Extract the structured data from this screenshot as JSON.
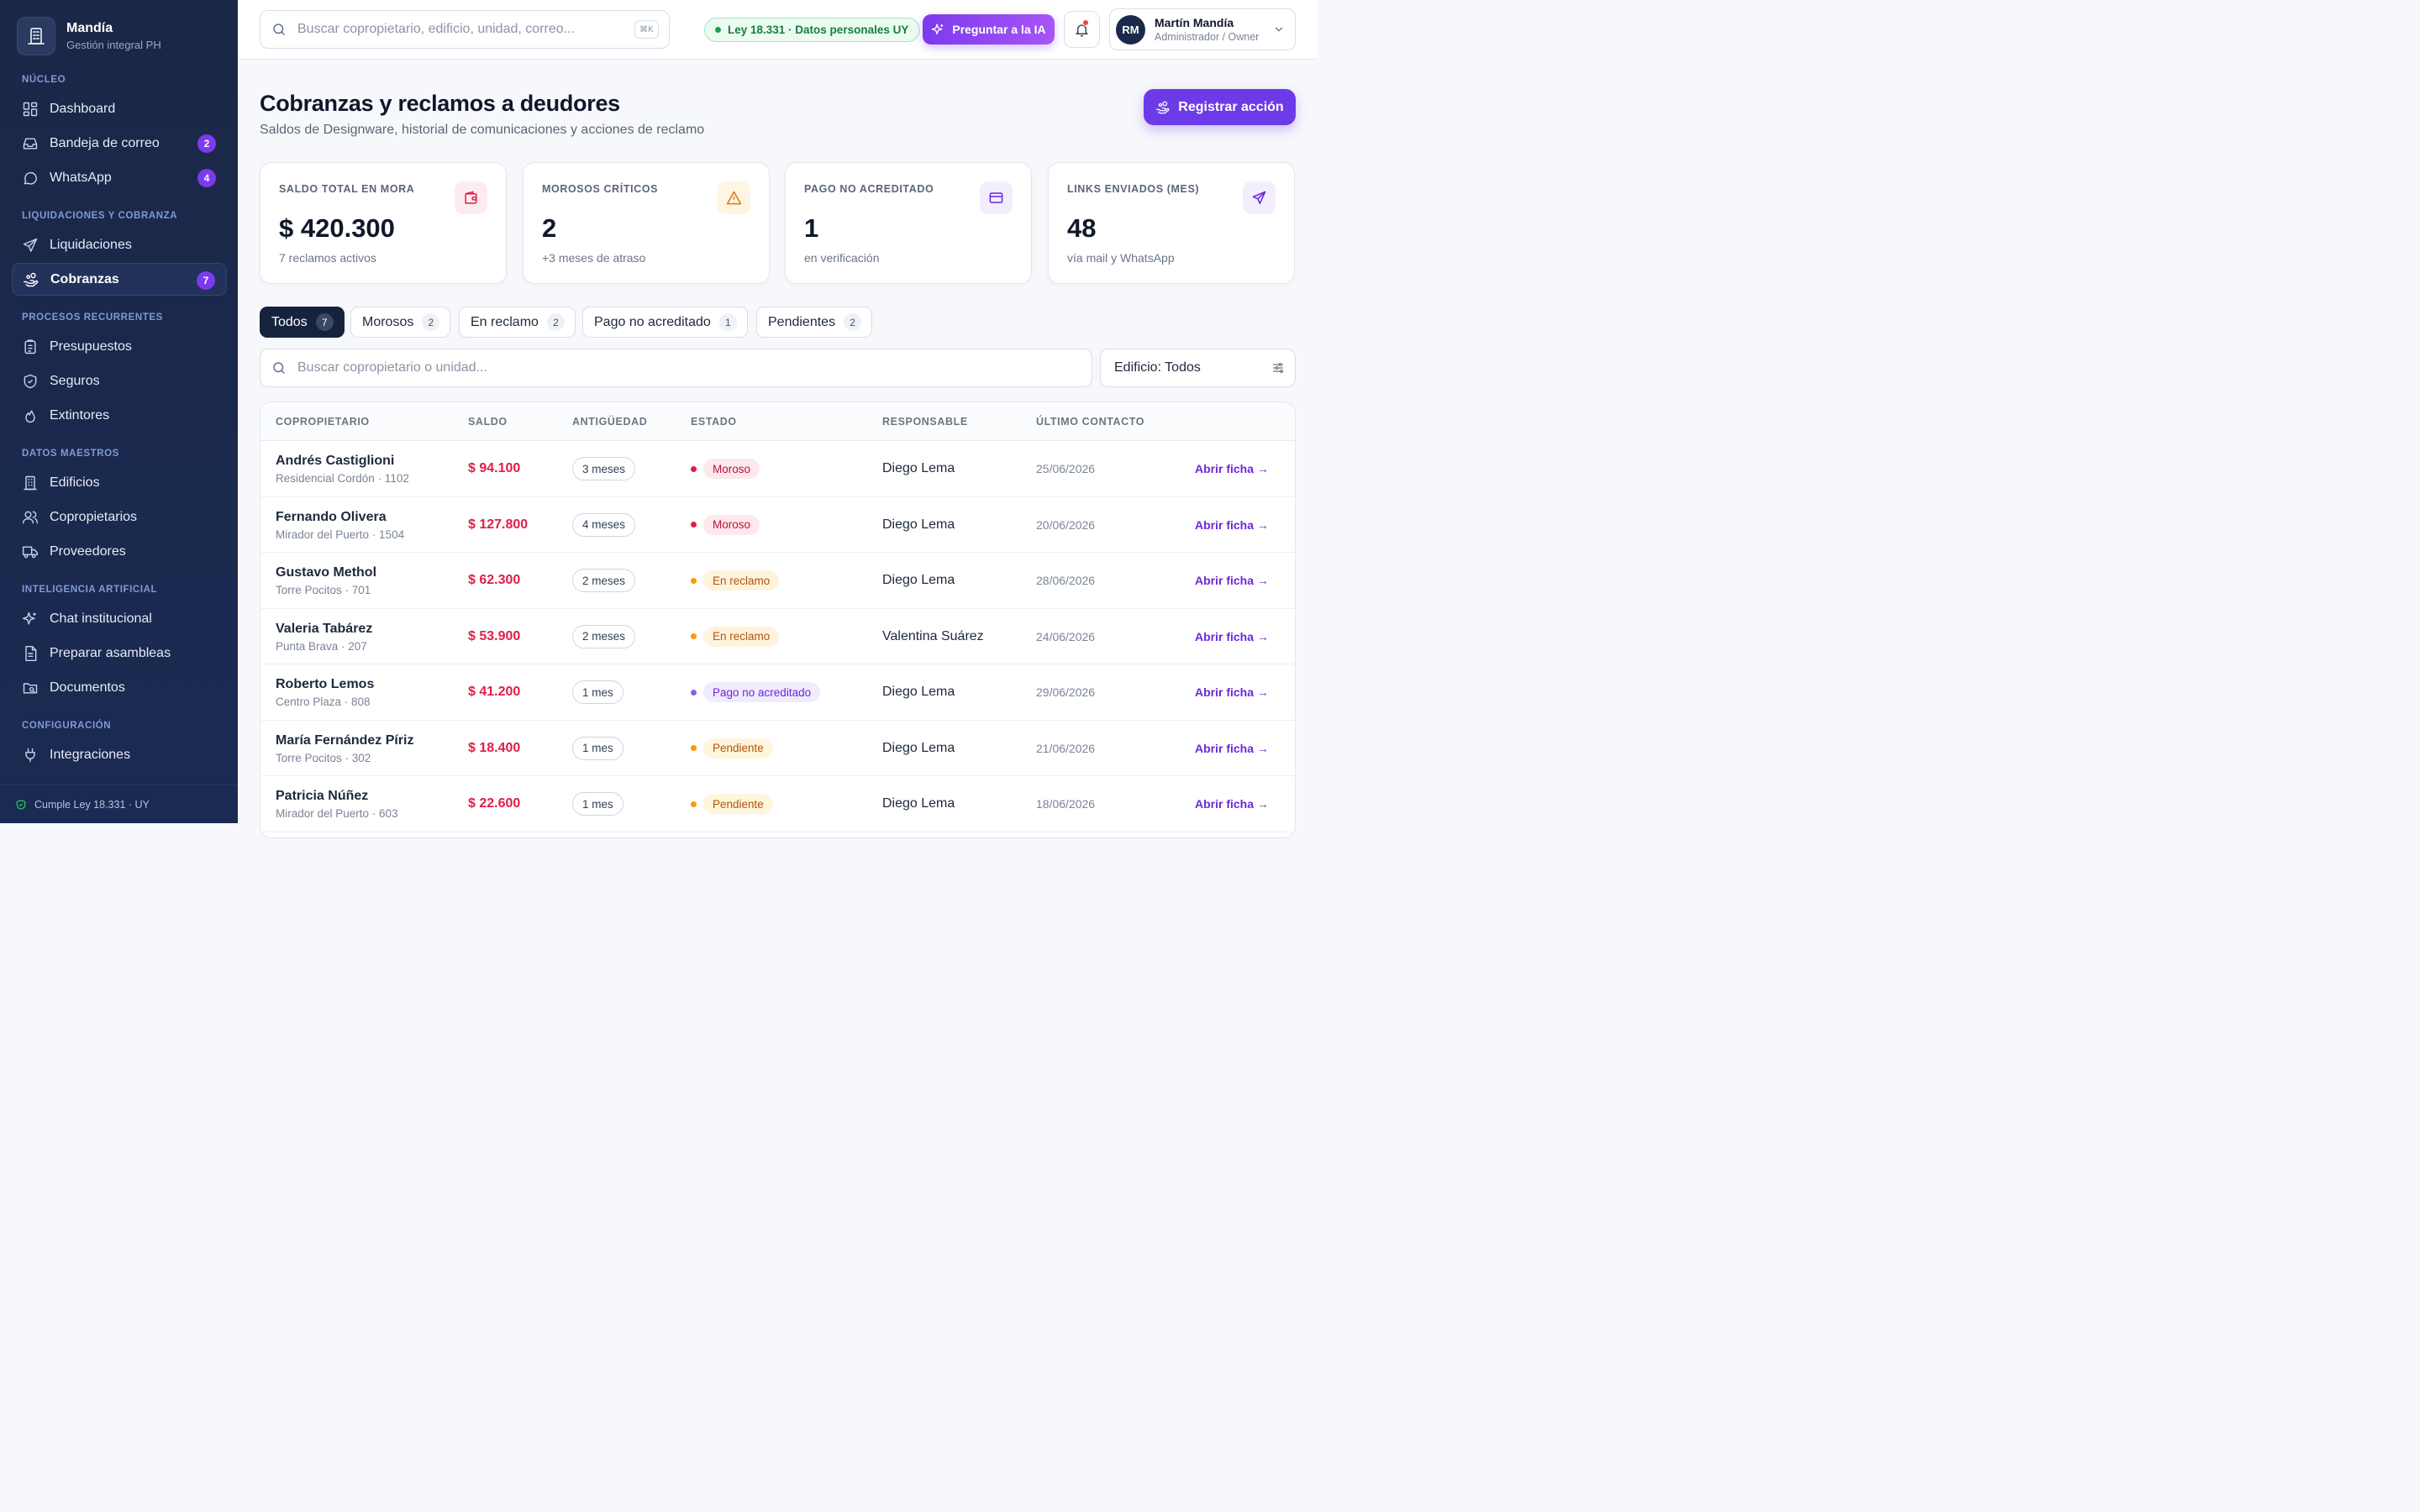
{
  "brand": {
    "name": "Mandía",
    "subtitle": "Gestión integral PH"
  },
  "sidebar": {
    "sections": [
      {
        "title": "NÚCLEO"
      },
      {
        "title": "LIQUIDACIONES Y COBRANZA"
      },
      {
        "title": "PROCESOS RECURRENTES"
      },
      {
        "title": "DATOS MAESTROS"
      },
      {
        "title": "INTELIGENCIA ARTIFICIAL"
      },
      {
        "title": "CONFIGURACIÓN"
      }
    ],
    "items": [
      {
        "label": "Dashboard",
        "icon": "grid-icon"
      },
      {
        "label": "Bandeja de correo",
        "icon": "inbox-icon",
        "badge": "2"
      },
      {
        "label": "WhatsApp",
        "icon": "chat-bubble-icon",
        "badge": "4"
      },
      {
        "label": "Liquidaciones",
        "icon": "send-icon"
      },
      {
        "label": "Cobranzas",
        "icon": "hand-coins-icon",
        "badge": "7",
        "active": true
      },
      {
        "label": "Presupuestos",
        "icon": "clipboard-icon"
      },
      {
        "label": "Seguros",
        "icon": "shield-icon"
      },
      {
        "label": "Extintores",
        "icon": "flame-icon"
      },
      {
        "label": "Edificios",
        "icon": "building-icon"
      },
      {
        "label": "Copropietarios",
        "icon": "users-icon"
      },
      {
        "label": "Proveedores",
        "icon": "truck-icon"
      },
      {
        "label": "Chat institucional",
        "icon": "sparkles-icon"
      },
      {
        "label": "Preparar asambleas",
        "icon": "document-icon"
      },
      {
        "label": "Documentos",
        "icon": "folder-search-icon"
      },
      {
        "label": "Integraciones",
        "icon": "plug-icon"
      }
    ],
    "footer": "Cumple Ley 18.331 · UY"
  },
  "topbar": {
    "search_placeholder": "Buscar copropietario, edificio, unidad, correo...",
    "shortcut": "⌘K",
    "law_badge": "Ley 18.331 · Datos personales UY",
    "ai_button": "Preguntar a la IA",
    "user": {
      "initials": "RM",
      "name": "Martín Mandía",
      "role": "Administrador / Owner"
    }
  },
  "page": {
    "title": "Cobranzas y reclamos a deudores",
    "subtitle": "Saldos de Designware, historial de comunicaciones y acciones de reclamo",
    "primary_action": "Registrar acción"
  },
  "kpis": [
    {
      "label": "SALDO TOTAL EN MORA",
      "value": "$ 420.300",
      "sub": "7 reclamos activos",
      "icon": "wallet-icon",
      "color": "#e11d48"
    },
    {
      "label": "MOROSOS CRÍTICOS",
      "value": "2",
      "sub": "+3 meses de atraso",
      "icon": "warning-icon",
      "color": "#d97706"
    },
    {
      "label": "PAGO NO ACREDITADO",
      "value": "1",
      "sub": "en verificación",
      "icon": "credit-card-icon",
      "color": "#6d28d9"
    },
    {
      "label": "LINKS ENVIADOS (MES)",
      "value": "48",
      "sub": "vía mail y WhatsApp",
      "icon": "send-icon",
      "color": "#6d28d9"
    }
  ],
  "tabs": [
    {
      "label": "Todos",
      "count": "7",
      "active": true
    },
    {
      "label": "Morosos",
      "count": "2"
    },
    {
      "label": "En reclamo",
      "count": "2"
    },
    {
      "label": "Pago no acreditado",
      "count": "1"
    },
    {
      "label": "Pendientes",
      "count": "2"
    }
  ],
  "filters": {
    "search_placeholder": "Buscar copropietario o unidad...",
    "building": "Edificio: Todos"
  },
  "table": {
    "headers": [
      "COPROPIETARIO",
      "SALDO",
      "ANTIGÜEDAD",
      "ESTADO",
      "RESPONSABLE",
      "ÚLTIMO CONTACTO"
    ],
    "link_label": "Abrir ficha →",
    "rows": [
      {
        "name": "Andrés Castiglioni",
        "unit": "Residencial Cordón · 1102",
        "balance": "$ 94.100",
        "age": "3 meses",
        "status": "Moroso",
        "status_kind": "moroso",
        "responsible": "Diego Lema",
        "last_contact": "25/06/2026"
      },
      {
        "name": "Fernando Olivera",
        "unit": "Mirador del Puerto · 1504",
        "balance": "$ 127.800",
        "age": "4 meses",
        "status": "Moroso",
        "status_kind": "moroso",
        "responsible": "Diego Lema",
        "last_contact": "20/06/2026"
      },
      {
        "name": "Gustavo Methol",
        "unit": "Torre Pocitos · 701",
        "balance": "$ 62.300",
        "age": "2 meses",
        "status": "En reclamo",
        "status_kind": "reclamo",
        "responsible": "Diego Lema",
        "last_contact": "28/06/2026"
      },
      {
        "name": "Valeria Tabárez",
        "unit": "Punta Brava · 207",
        "balance": "$ 53.900",
        "age": "2 meses",
        "status": "En reclamo",
        "status_kind": "reclamo",
        "responsible": "Valentina Suárez",
        "last_contact": "24/06/2026"
      },
      {
        "name": "Roberto Lemos",
        "unit": "Centro Plaza · 808",
        "balance": "$ 41.200",
        "age": "1 mes",
        "status": "Pago no acreditado",
        "status_kind": "pago",
        "responsible": "Diego Lema",
        "last_contact": "29/06/2026"
      },
      {
        "name": "María Fernández Píriz",
        "unit": "Torre Pocitos · 302",
        "balance": "$ 18.400",
        "age": "1 mes",
        "status": "Pendiente",
        "status_kind": "pendiente",
        "responsible": "Diego Lema",
        "last_contact": "21/06/2026"
      },
      {
        "name": "Patricia Núñez",
        "unit": "Mirador del Puerto · 603",
        "balance": "$ 22.600",
        "age": "1 mes",
        "status": "Pendiente",
        "status_kind": "pendiente",
        "responsible": "Diego Lema",
        "last_contact": "18/06/2026"
      }
    ]
  },
  "status_colors": {
    "moroso": {
      "dot": "#e11d48",
      "bg": "#fde8ec",
      "fg": "#be123c"
    },
    "reclamo": {
      "dot": "#f59e0b",
      "bg": "#fef3dc",
      "fg": "#b45309"
    },
    "pago": {
      "dot": "#8b5cf6",
      "bg": "#f1ebfe",
      "fg": "#6d28d9"
    },
    "pendiente": {
      "dot": "#f59e0b",
      "bg": "#fef6dc",
      "fg": "#b45309"
    }
  }
}
